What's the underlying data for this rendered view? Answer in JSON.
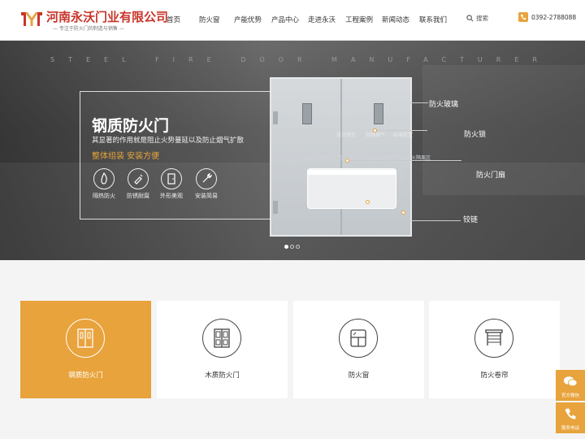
{
  "header": {
    "company_name": "河南永沃门业有限公司",
    "slogan": "专注于防火门的制造与销售",
    "nav": [
      "首页",
      "防火窗",
      "产能优势",
      "产品中心",
      "走进永沃",
      "工程案例",
      "新闻动态",
      "联系我们"
    ],
    "search_label": "搜索",
    "phone": "0392-2788088"
  },
  "banner": {
    "sub_en": "STEEL FIRE DOOR MANUFACTURER",
    "title": "钢质防火门",
    "description": "其显著的作用就是阻止火势蔓延以及防止烟气扩散",
    "subtitle": "整体组装 安装方便",
    "features": [
      "隔热防火",
      "防锈耐腐",
      "外形美观",
      "安装简易"
    ],
    "door_tags": [
      "设计理念",
      "阻隔烟气",
      "标准配置"
    ],
    "door_text": "应用于商场、住宅、酒店、工业与民用建筑中的防火隔离区",
    "annotations": [
      "防火玻璃",
      "防火锁",
      "防火门扇",
      "铰链"
    ],
    "slides": 3,
    "active_slide": 1
  },
  "categories": [
    {
      "label": "钢质防火门",
      "active": true,
      "icon": "steel-door-icon"
    },
    {
      "label": "木质防火门",
      "active": false,
      "icon": "wood-door-icon"
    },
    {
      "label": "防火窗",
      "active": false,
      "icon": "window-icon"
    },
    {
      "label": "防火卷帘",
      "active": false,
      "icon": "shutter-icon"
    }
  ],
  "side_tools": [
    {
      "label": "官方微信",
      "icon": "wechat-icon"
    },
    {
      "label": "服务电话",
      "icon": "phone-icon"
    }
  ],
  "colors": {
    "accent": "#e8a33c",
    "brand": "#c8352a"
  }
}
